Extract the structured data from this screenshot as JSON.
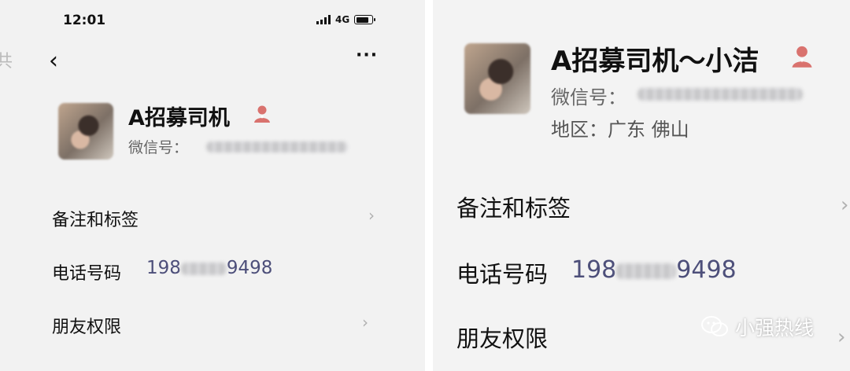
{
  "status_bar": {
    "time": "12:01",
    "network": "4G"
  },
  "icons": {
    "back": "back-chevron-icon",
    "more": "more-dots-icon",
    "profile": "person-icon",
    "watermark": "wechat-icon"
  },
  "left": {
    "edge_char": "共",
    "back_glyph": "‹",
    "more_glyph": "···",
    "name": "A招募司机",
    "wxid_label": "微信号：",
    "rows": {
      "remarks_label": "备注和标签",
      "phone_label": "电话号码",
      "phone_prefix": "198",
      "phone_suffix": "9498",
      "friend_label": "朋友权限"
    },
    "chevron": "›"
  },
  "right": {
    "name": "A招募司机～小洁",
    "wxid_label": "微信号：",
    "region": "地区：广东 佛山",
    "rows": {
      "remarks_label": "备注和标签",
      "phone_label": "电话号码",
      "phone_prefix": "198",
      "phone_suffix": "9498",
      "friend_label": "朋友权限"
    },
    "chevron": "›"
  },
  "watermark": {
    "text": "小强热线"
  },
  "colors": {
    "phone": "#4d4f7a",
    "profile_icon": "#d9726e"
  }
}
